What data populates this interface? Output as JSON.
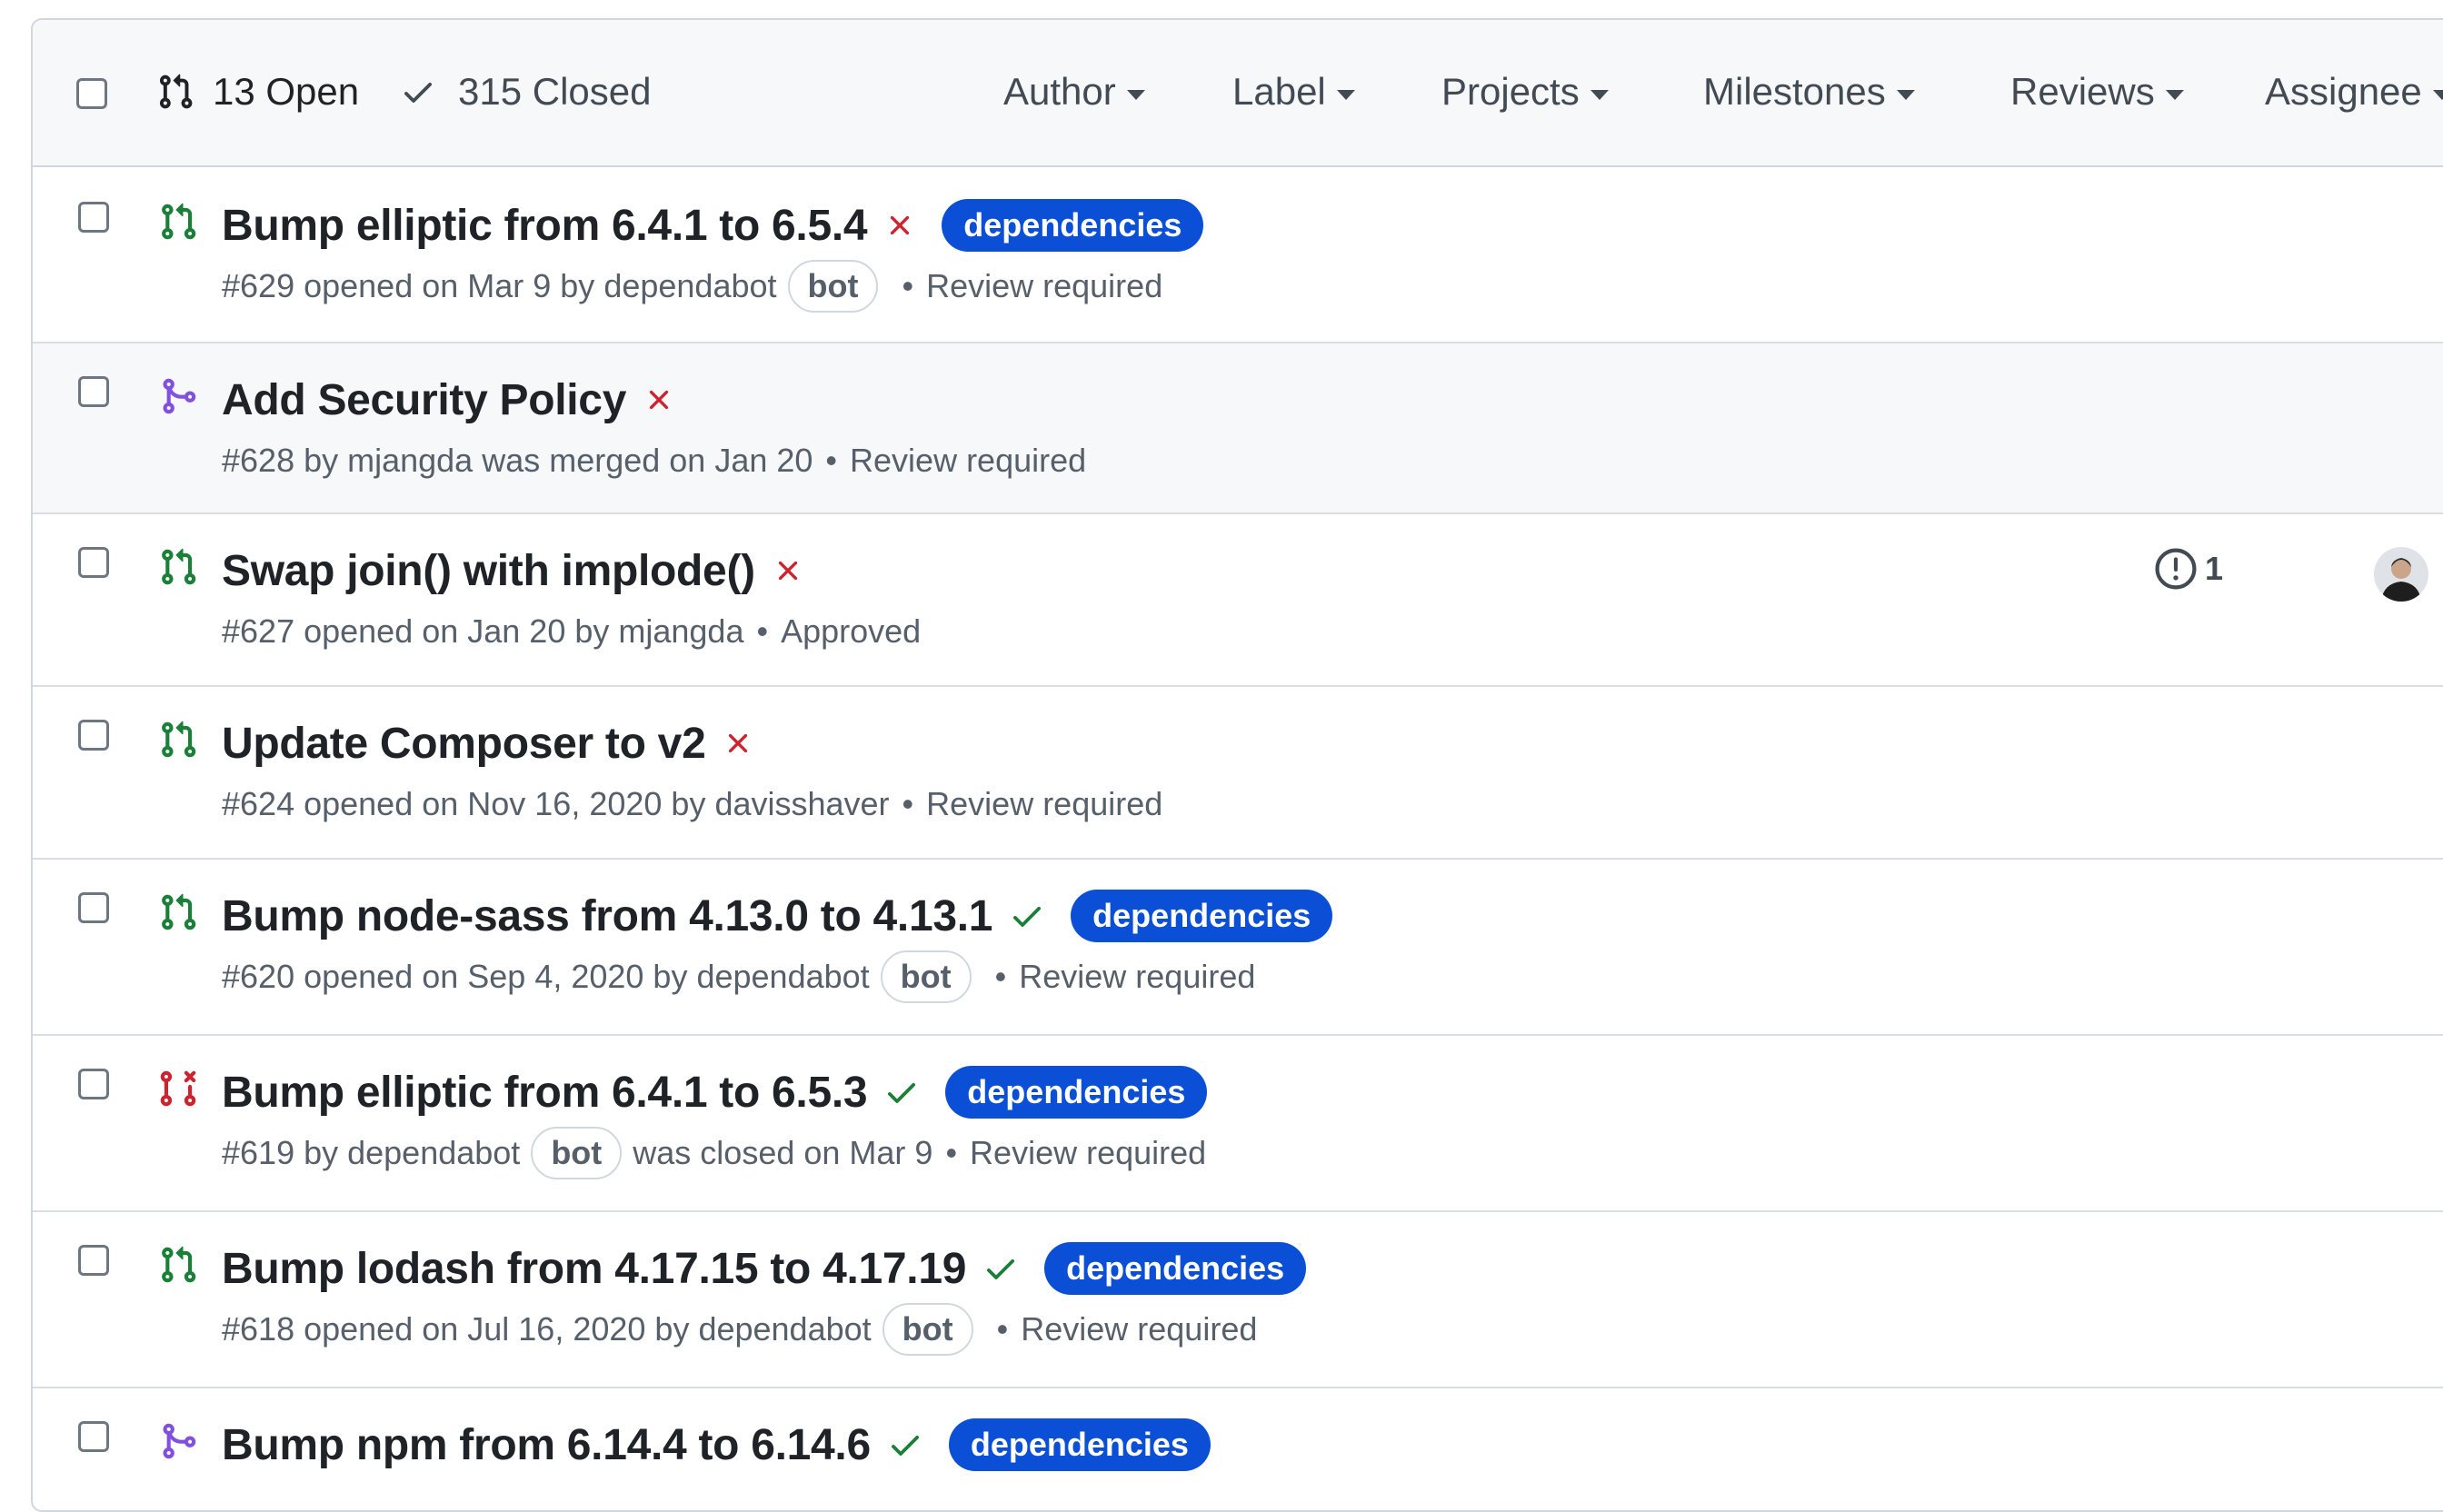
{
  "header": {
    "open_label": "13 Open",
    "closed_label": "315 Closed",
    "filters": [
      "Author",
      "Label",
      "Projects",
      "Milestones",
      "Reviews",
      "Assignee"
    ]
  },
  "pull_requests": [
    {
      "title": "Bump elliptic from 6.4.1 to 6.5.4",
      "ci": "fail",
      "status": "open",
      "label": "dependencies",
      "meta_prefix": "#629 opened on Mar 9 by",
      "author": "dependabot",
      "bot": "bot",
      "meta_suffix": "",
      "review": "Review required"
    },
    {
      "title": "Add Security Policy",
      "ci": "fail",
      "status": "merged",
      "label": "",
      "meta_prefix": "#628 by",
      "author": "mjangda",
      "bot": "",
      "meta_suffix": "was merged on Jan 20",
      "review": "Review required"
    },
    {
      "title": "Swap join() with implode()",
      "ci": "fail",
      "status": "open",
      "label": "",
      "meta_prefix": "#627 opened on Jan 20 by",
      "author": "mjangda",
      "bot": "",
      "meta_suffix": "",
      "review": "Approved",
      "linked_issues": "1",
      "has_avatar": true
    },
    {
      "title": "Update Composer to v2",
      "ci": "fail",
      "status": "open",
      "label": "",
      "meta_prefix": "#624 opened on Nov 16, 2020 by",
      "author": "davisshaver",
      "bot": "",
      "meta_suffix": "",
      "review": "Review required"
    },
    {
      "title": "Bump node-sass from 4.13.0 to 4.13.1",
      "ci": "pass",
      "status": "open",
      "label": "dependencies",
      "meta_prefix": "#620 opened on Sep 4, 2020 by",
      "author": "dependabot",
      "bot": "bot",
      "meta_suffix": "",
      "review": "Review required"
    },
    {
      "title": "Bump elliptic from 6.4.1 to 6.5.3",
      "ci": "pass",
      "status": "closed",
      "label": "dependencies",
      "meta_prefix": "#619 by",
      "author": "dependabot",
      "bot": "bot",
      "meta_suffix": "was closed on Mar 9",
      "review": "Review required"
    },
    {
      "title": "Bump lodash from 4.17.15 to 4.17.19",
      "ci": "pass",
      "status": "open",
      "label": "dependencies",
      "meta_prefix": "#618 opened on Jul 16, 2020 by",
      "author": "dependabot",
      "bot": "bot",
      "meta_suffix": "",
      "review": "Review required"
    },
    {
      "title": "Bump npm from 6.14.4 to 6.14.6",
      "ci": "pass",
      "status": "merged",
      "label": "dependencies",
      "meta_prefix": "",
      "author": "",
      "bot": "",
      "meta_suffix": "",
      "review": ""
    }
  ],
  "colors": {
    "open": "#1a7f37",
    "merged": "#8250df",
    "closed": "#cf222e",
    "fail": "#cf222e",
    "pass": "#1a7f37",
    "label_bg": "#0a4fd6"
  },
  "icons": {
    "open": "git-pull-request-icon",
    "merged": "git-merge-icon",
    "closed": "git-pull-request-closed-icon",
    "fail": "x-icon",
    "pass": "check-icon",
    "linked_issue": "issue-opened-icon",
    "checkmark_header": "check-icon"
  }
}
